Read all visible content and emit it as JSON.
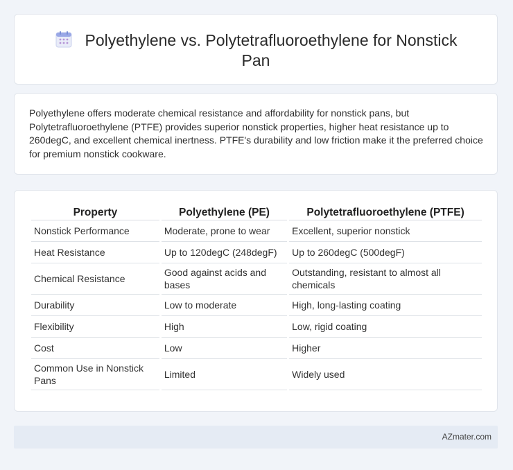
{
  "header": {
    "icon": "calendar-icon",
    "title": "Polyethylene vs. Polytetrafluoroethylene for Nonstick Pan"
  },
  "summary": {
    "text": "Polyethylene offers moderate chemical resistance and affordability for nonstick pans, but Polytetrafluoroethylene (PTFE) provides superior nonstick properties, higher heat resistance up to 260degC, and excellent chemical inertness. PTFE's durability and low friction make it the preferred choice for premium nonstick cookware."
  },
  "table": {
    "headers": [
      "Property",
      "Polyethylene (PE)",
      "Polytetrafluoroethylene (PTFE)"
    ],
    "rows": [
      [
        "Nonstick Performance",
        "Moderate, prone to wear",
        "Excellent, superior nonstick"
      ],
      [
        "Heat Resistance",
        "Up to 120degC (248degF)",
        "Up to 260degC (500degF)"
      ],
      [
        "Chemical Resistance",
        "Good against acids and bases",
        "Outstanding, resistant to almost all chemicals"
      ],
      [
        "Durability",
        "Low to moderate",
        "High, long-lasting coating"
      ],
      [
        "Flexibility",
        "High",
        "Low, rigid coating"
      ],
      [
        "Cost",
        "Low",
        "Higher"
      ],
      [
        "Common Use in Nonstick Pans",
        "Limited",
        "Widely used"
      ]
    ]
  },
  "footer": {
    "brand": "AZmater.com"
  },
  "colors": {
    "background": "#f1f4f9",
    "card": "#ffffff",
    "footer": "#e5ebf4",
    "icon_accent": "#7b8fd6"
  }
}
